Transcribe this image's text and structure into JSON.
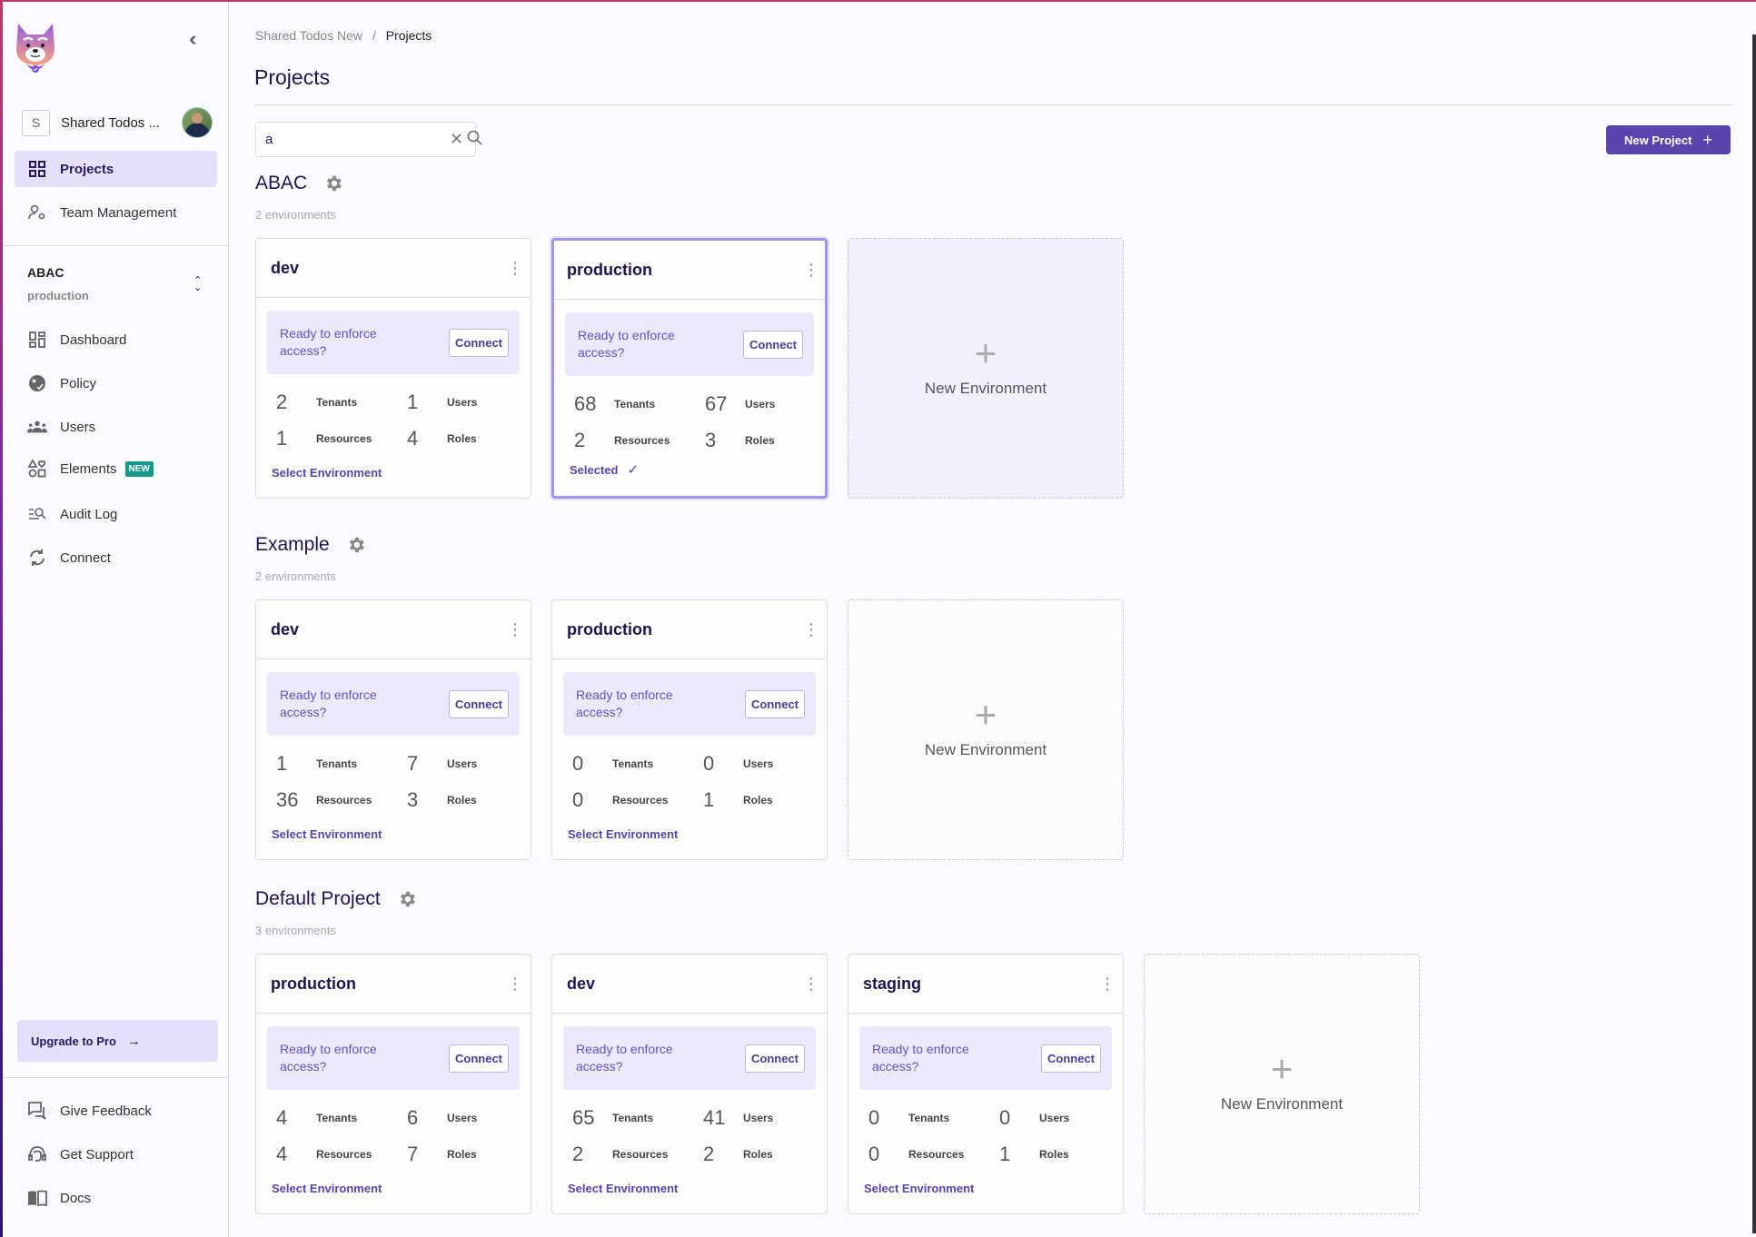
{
  "sidebar": {
    "collapse_icon": "double-chevron-left",
    "org": {
      "initial": "S",
      "name": "Shared Todos ..."
    },
    "top_nav": [
      {
        "label": "Projects",
        "icon": "grid-icon",
        "active": true
      },
      {
        "label": "Team Management",
        "icon": "user-gear-icon",
        "active": false
      }
    ],
    "env_switcher": {
      "project": "ABAC",
      "environment": "production"
    },
    "env_nav": [
      {
        "label": "Dashboard",
        "icon": "dashboard-icon"
      },
      {
        "label": "Policy",
        "icon": "policy-icon"
      },
      {
        "label": "Users",
        "icon": "users-icon"
      },
      {
        "label": "Elements",
        "icon": "elements-icon",
        "badge": "NEW"
      },
      {
        "label": "Audit Log",
        "icon": "audit-log-icon"
      },
      {
        "label": "Connect",
        "icon": "sync-icon"
      }
    ],
    "upgrade_label": "Upgrade to Pro",
    "bottom_nav": [
      {
        "label": "Give Feedback",
        "icon": "feedback-icon"
      },
      {
        "label": "Get Support",
        "icon": "support-icon"
      },
      {
        "label": "Docs",
        "icon": "book-icon"
      }
    ]
  },
  "breadcrumb": {
    "parent": "Shared Todos New",
    "separator": "/",
    "current": "Projects"
  },
  "page_title": "Projects",
  "search": {
    "value": "a",
    "placeholder": ""
  },
  "new_project_label": "New Project",
  "new_environment_label": "New Environment",
  "card_labels": {
    "connect_prompt": "Ready to enforce access?",
    "connect_button": "Connect",
    "tenants": "Tenants",
    "users": "Users",
    "resources": "Resources",
    "roles": "Roles",
    "select": "Select Environment",
    "selected": "Selected"
  },
  "colors": {
    "accent": "#5a44ac",
    "accent_light": "#e4e0fa",
    "badge_new": "#12998a"
  },
  "projects": [
    {
      "name": "ABAC",
      "env_count": "2 environments",
      "environments": [
        {
          "name": "dev",
          "tenants": "2",
          "users": "1",
          "resources": "1",
          "roles": "4",
          "selected": false
        },
        {
          "name": "production",
          "tenants": "68",
          "users": "67",
          "resources": "2",
          "roles": "3",
          "selected": true
        }
      ]
    },
    {
      "name": "Example",
      "env_count": "2 environments",
      "environments": [
        {
          "name": "dev",
          "tenants": "1",
          "users": "7",
          "resources": "36",
          "roles": "3",
          "selected": false
        },
        {
          "name": "production",
          "tenants": "0",
          "users": "0",
          "resources": "0",
          "roles": "1",
          "selected": false
        }
      ]
    },
    {
      "name": "Default Project",
      "env_count": "3 environments",
      "environments": [
        {
          "name": "production",
          "tenants": "4",
          "users": "6",
          "resources": "4",
          "roles": "7",
          "selected": false
        },
        {
          "name": "dev",
          "tenants": "65",
          "users": "41",
          "resources": "2",
          "roles": "2",
          "selected": false
        },
        {
          "name": "staging",
          "tenants": "0",
          "users": "0",
          "resources": "0",
          "roles": "1",
          "selected": false
        }
      ]
    }
  ]
}
